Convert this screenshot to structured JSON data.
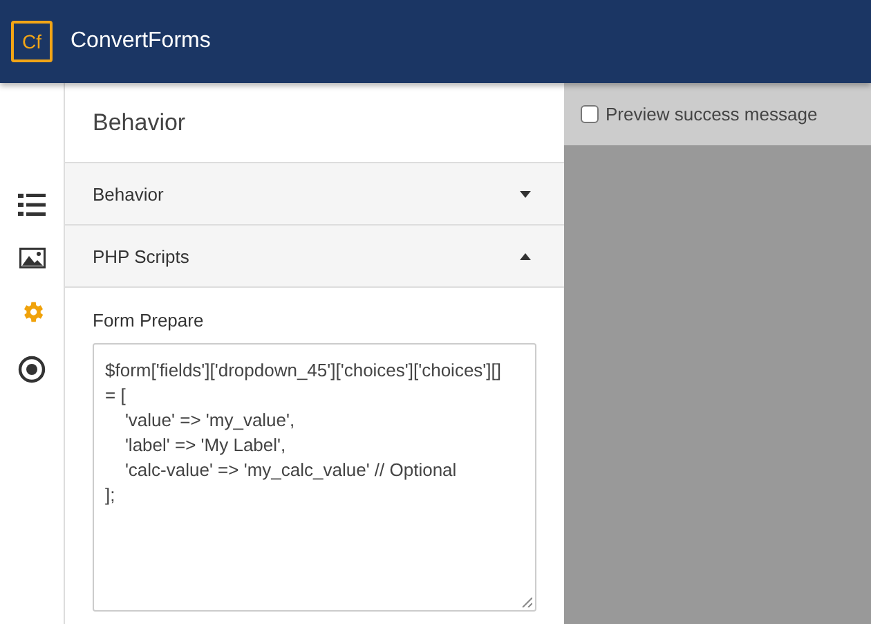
{
  "header": {
    "logo_mark": "Cf",
    "brand": "ConvertForms"
  },
  "rail": [
    {
      "kind": "list",
      "selected": false
    },
    {
      "kind": "image",
      "selected": false
    },
    {
      "kind": "gear",
      "selected": true
    },
    {
      "kind": "target",
      "selected": false
    }
  ],
  "panel": {
    "title": "Behavior",
    "sections": [
      {
        "label": "Behavior",
        "expanded": false
      },
      {
        "label": "PHP Scripts",
        "expanded": true
      }
    ],
    "field_label": "Form Prepare",
    "code": "$form['fields']['dropdown_45']['choices']['choices'][] = [\n    'value' => 'my_value',\n    'label' => 'My Label',\n    'calc-value' => 'my_calc_value' // Optional\n];"
  },
  "preview": {
    "label": "Preview success message",
    "checked": false
  }
}
